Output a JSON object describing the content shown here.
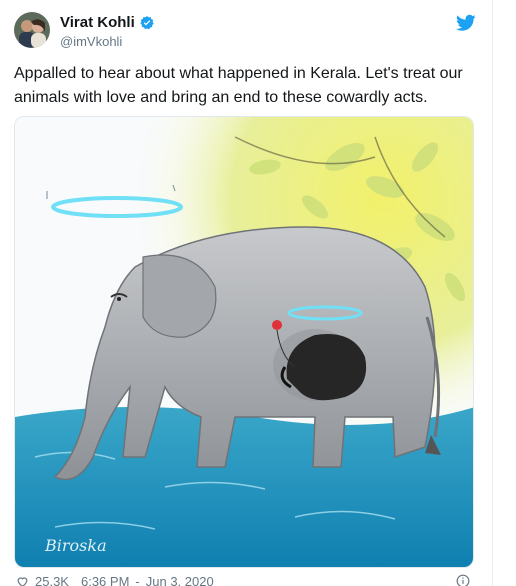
{
  "author": {
    "name": "Virat Kohli",
    "handle": "@imVkohli"
  },
  "tweet": {
    "text": "Appalled to hear about what happened in Kerala. Let's treat our animals with love and bring an end to these cowardly acts."
  },
  "media": {
    "signature": "Biroska"
  },
  "footer": {
    "likes": "25.3K",
    "time": "6:36 PM",
    "separator": "-",
    "date": "Jun 3, 2020"
  },
  "colors": {
    "brand": "#1da1f2",
    "text": "#14171a",
    "muted": "#657786"
  },
  "icons": [
    "verified-icon",
    "twitter-bird-icon",
    "heart-icon",
    "info-icon"
  ]
}
